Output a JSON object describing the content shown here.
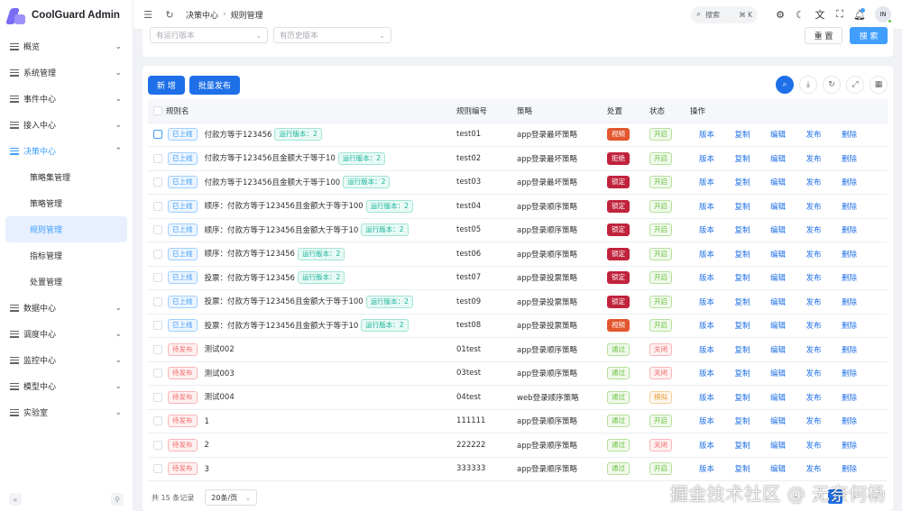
{
  "app": {
    "title": "CoolGuard Admin"
  },
  "sidebar": {
    "items": [
      {
        "label": "概览",
        "open": false
      },
      {
        "label": "系统管理",
        "open": false
      },
      {
        "label": "事件中心",
        "open": false
      },
      {
        "label": "接入中心",
        "open": false
      },
      {
        "label": "决策中心",
        "open": true,
        "children": [
          "策略集管理",
          "策略管理",
          "规则管理",
          "指标管理",
          "处置管理"
        ],
        "active_child": "规则管理"
      },
      {
        "label": "数据中心",
        "open": false
      },
      {
        "label": "调度中心",
        "open": false
      },
      {
        "label": "监控中心",
        "open": false
      },
      {
        "label": "模型中心",
        "open": false
      },
      {
        "label": "实验室",
        "open": false
      }
    ]
  },
  "header": {
    "breadcrumb": [
      "决策中心",
      "规则管理"
    ],
    "search_label": "搜索",
    "search_shortcut": "⌘ K",
    "avatar_text": "IN"
  },
  "filter": {
    "select1_placeholder": "有运行版本",
    "select2_placeholder": "有历史版本",
    "reset_label": "重 置",
    "search_label": "搜 索"
  },
  "toolbar": {
    "add_label": "新 增",
    "batch_publish_label": "批量发布"
  },
  "table": {
    "columns": [
      "规则名",
      "规则编号",
      "策略",
      "处置",
      "状态",
      "操作"
    ],
    "actions": [
      "版本",
      "复制",
      "编辑",
      "发布",
      "删除"
    ],
    "rows": [
      {
        "publish": "已上线",
        "publish_type": "online",
        "name": "付款方等于123456",
        "version": "运行版本：2",
        "code": "test01",
        "strategy": "app登录最坏策略",
        "disposal": "视频",
        "disposal_type": "solid-orange",
        "status": "开启",
        "status_type": "st-open"
      },
      {
        "publish": "已上线",
        "publish_type": "online",
        "name": "付款方等于123456且金额大于等于10",
        "version": "运行版本：2",
        "code": "test02",
        "strategy": "app登录最坏策略",
        "disposal": "拒绝",
        "disposal_type": "solid-red",
        "status": "开启",
        "status_type": "st-open"
      },
      {
        "publish": "已上线",
        "publish_type": "online",
        "name": "付款方等于123456且金额大于等于100",
        "version": "运行版本：2",
        "code": "test03",
        "strategy": "app登录最坏策略",
        "disposal": "锁定",
        "disposal_type": "solid-red",
        "status": "开启",
        "status_type": "st-open"
      },
      {
        "publish": "已上线",
        "publish_type": "online",
        "name": "顺序：付款方等于123456且金额大于等于100",
        "version": "运行版本：2",
        "code": "test04",
        "strategy": "app登录顺序策略",
        "disposal": "锁定",
        "disposal_type": "solid-red",
        "status": "开启",
        "status_type": "st-open"
      },
      {
        "publish": "已上线",
        "publish_type": "online",
        "name": "顺序：付款方等于123456且金额大于等于10",
        "version": "运行版本：2",
        "code": "test05",
        "strategy": "app登录顺序策略",
        "disposal": "锁定",
        "disposal_type": "solid-red",
        "status": "开启",
        "status_type": "st-open"
      },
      {
        "publish": "已上线",
        "publish_type": "online",
        "name": "顺序：付款方等于123456",
        "version": "运行版本：2",
        "code": "test06",
        "strategy": "app登录顺序策略",
        "disposal": "锁定",
        "disposal_type": "solid-red",
        "status": "开启",
        "status_type": "st-open"
      },
      {
        "publish": "已上线",
        "publish_type": "online",
        "name": "投票：付款方等于123456",
        "version": "运行版本：2",
        "code": "test07",
        "strategy": "app登录投票策略",
        "disposal": "锁定",
        "disposal_type": "solid-red",
        "status": "开启",
        "status_type": "st-open"
      },
      {
        "publish": "已上线",
        "publish_type": "online",
        "name": "投票：付款方等于123456且金额大于等于100",
        "version": "运行版本：2",
        "code": "test09",
        "strategy": "app登录投票策略",
        "disposal": "锁定",
        "disposal_type": "solid-red",
        "status": "开启",
        "status_type": "st-open"
      },
      {
        "publish": "已上线",
        "publish_type": "online",
        "name": "投票：付款方等于123456且金额大于等于10",
        "version": "运行版本：2",
        "code": "test08",
        "strategy": "app登录投票策略",
        "disposal": "视频",
        "disposal_type": "solid-orange",
        "status": "开启",
        "status_type": "st-open"
      },
      {
        "publish": "待发布",
        "publish_type": "pending",
        "name": "测试002",
        "version": "",
        "code": "01test",
        "strategy": "app登录顺序策略",
        "disposal": "通过",
        "disposal_type": "solid-green",
        "status": "关闭",
        "status_type": "st-close"
      },
      {
        "publish": "待发布",
        "publish_type": "pending",
        "name": "测试003",
        "version": "",
        "code": "03test",
        "strategy": "app登录顺序策略",
        "disposal": "通过",
        "disposal_type": "solid-green",
        "status": "关闭",
        "status_type": "st-close"
      },
      {
        "publish": "待发布",
        "publish_type": "pending",
        "name": "测试004",
        "version": "",
        "code": "04test",
        "strategy": "web登录顺序策略",
        "disposal": "通过",
        "disposal_type": "solid-green",
        "status": "模拟",
        "status_type": "st-sim"
      },
      {
        "publish": "待发布",
        "publish_type": "pending",
        "name": "1",
        "version": "",
        "code": "111111",
        "strategy": "app登录顺序策略",
        "disposal": "通过",
        "disposal_type": "solid-green",
        "status": "开启",
        "status_type": "st-open"
      },
      {
        "publish": "待发布",
        "publish_type": "pending",
        "name": "2",
        "version": "",
        "code": "222222",
        "strategy": "app登录顺序策略",
        "disposal": "通过",
        "disposal_type": "solid-green",
        "status": "关闭",
        "status_type": "st-close"
      },
      {
        "publish": "待发布",
        "publish_type": "pending",
        "name": "3",
        "version": "",
        "code": "333333",
        "strategy": "app登录顺序策略",
        "disposal": "通过",
        "disposal_type": "solid-green",
        "status": "开启",
        "status_type": "st-open"
      }
    ]
  },
  "pager": {
    "total_text": "共 15 条记录",
    "page_size": "20条/页",
    "current_page": "1"
  },
  "watermark": "掘金技术社区 @ 无奈何杨",
  "colors": {
    "primary": "#1e6fe8",
    "accent": "#409eff",
    "danger": "#c0233c",
    "warning": "#e2572f",
    "success": "#67c23a"
  }
}
